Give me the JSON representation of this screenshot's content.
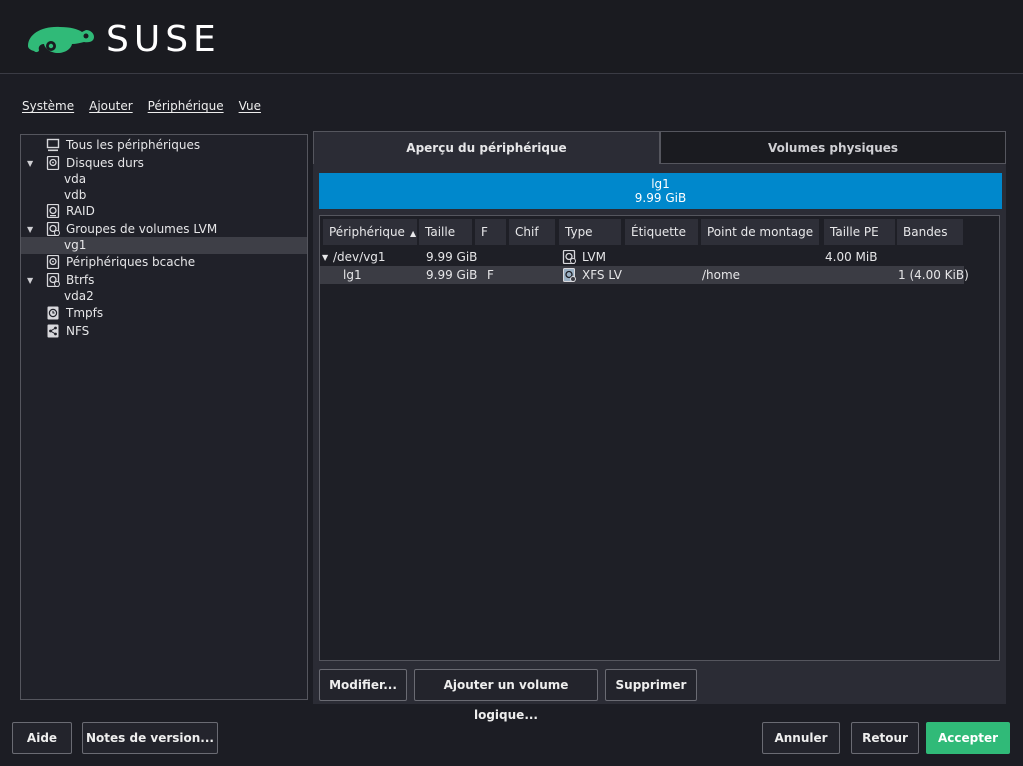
{
  "header": {
    "logo_text": "SUSE",
    "logo_icon": "chameleon-icon"
  },
  "menu": {
    "items": [
      "Système",
      "Ajouter",
      "Périphérique",
      "Vue"
    ]
  },
  "tree": {
    "items": [
      {
        "label": "Tous les périphériques",
        "icon": "monitor-icon"
      },
      {
        "label": "Disques durs",
        "icon": "hard-disk-icon",
        "expanded": true
      },
      {
        "label": "vda"
      },
      {
        "label": "vdb"
      },
      {
        "label": "RAID",
        "icon": "raid-icon"
      },
      {
        "label": "Groupes de volumes LVM",
        "icon": "lvm-icon",
        "expanded": true
      },
      {
        "label": "vg1",
        "selected": true
      },
      {
        "label": "Périphériques bcache",
        "icon": "bcache-icon"
      },
      {
        "label": "Btrfs",
        "icon": "btrfs-icon",
        "expanded": true
      },
      {
        "label": "vda2"
      },
      {
        "label": "Tmpfs",
        "icon": "clock-icon"
      },
      {
        "label": "NFS",
        "icon": "share-icon"
      }
    ]
  },
  "tabs": {
    "overview": "Aperçu du périphérique",
    "physical": "Volumes physiques"
  },
  "bar": {
    "name": "lg1",
    "size": "9.99 GiB"
  },
  "table": {
    "columns": [
      "Périphérique",
      "Taille",
      "F",
      "Chif",
      "Type",
      "Étiquette",
      "Point de montage",
      "Taille PE",
      "Bandes"
    ],
    "rows": [
      {
        "device": "/dev/vg1",
        "size": "9.99 GiB",
        "f": "",
        "enc": "",
        "type": "LVM",
        "label": "",
        "mount": "",
        "pe": "4.00 MiB",
        "stripes": ""
      },
      {
        "device": "lg1",
        "size": "9.99 GiB",
        "f": "F",
        "enc": "",
        "type": "XFS LV",
        "label": "",
        "mount": "/home",
        "pe": "",
        "stripes": "1 (4.00 KiB)"
      }
    ]
  },
  "buttons": {
    "modify": "Modifier...",
    "add_lv": "Ajouter un volume logique...",
    "delete": "Supprimer",
    "help": "Aide",
    "release_notes": "Notes de version...",
    "cancel": "Annuler",
    "back": "Retour",
    "accept": "Accepter"
  },
  "colors": {
    "accent": "#30ba78",
    "bar": "#0088cc",
    "background": "#1c1d24"
  }
}
